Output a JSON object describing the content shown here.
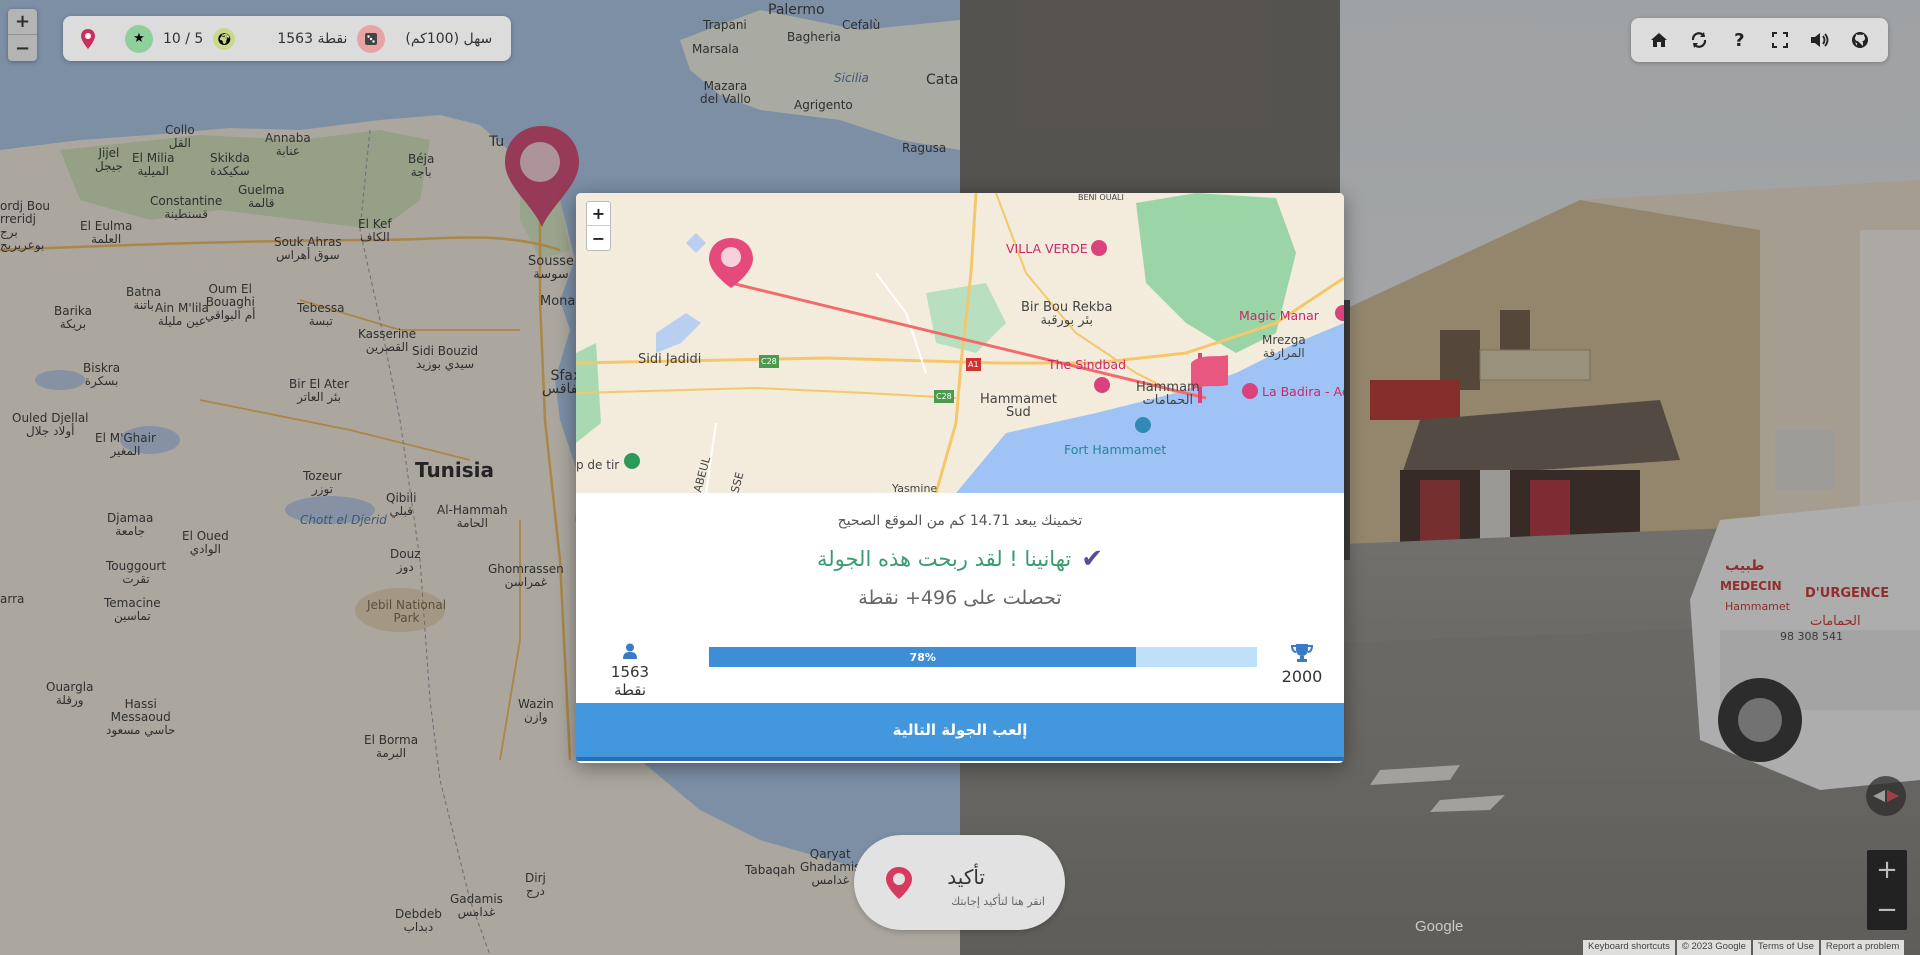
{
  "stats": {
    "mode_label": "سهل (100كم)",
    "score_label": "1563 نقطة",
    "round_label": "10 / 5"
  },
  "left_map": {
    "zoom_in": "+",
    "zoom_out": "−",
    "places": [
      {
        "name": "Palermo"
      },
      {
        "name": "Trapani"
      },
      {
        "name": "Marsala"
      },
      {
        "name": "Bagheria"
      },
      {
        "name": "Cefalù"
      },
      {
        "name": "Sicilia"
      },
      {
        "name": "Mazara\ndel Vallo"
      },
      {
        "name": "Agrigento"
      },
      {
        "name": "Ragusa"
      },
      {
        "name": "Cata"
      },
      {
        "name": "Collo\nالقل"
      },
      {
        "name": "Annaba\nعنابة"
      },
      {
        "name": "Jijel\nجيجل"
      },
      {
        "name": "El Milia\nالميلية"
      },
      {
        "name": "Skikda\nسكيكدة"
      },
      {
        "name": "Constantine\nقسنطينة"
      },
      {
        "name": "Guelma\nقالمة"
      },
      {
        "name": "Béja\nباجة"
      },
      {
        "name": "Tu"
      },
      {
        "name": "El Kef\nالكاف"
      },
      {
        "name": "Souk Ahras\nسوق أهراس"
      },
      {
        "name": "El Eulma\nالعلمة"
      },
      {
        "name": "Oum El\nBouaghi\nأم البواقي"
      },
      {
        "name": "Batna\nباتنة"
      },
      {
        "name": "Barika\nبريكة"
      },
      {
        "name": "Ain M'lila\nعين مليلة"
      },
      {
        "name": "Tebessa\nتبسة"
      },
      {
        "name": "Sousse\nسوسة"
      },
      {
        "name": "Monas"
      },
      {
        "name": "Kasserine\nالقصرين"
      },
      {
        "name": "Sidi Bouzid\nسيدي بوزيد"
      },
      {
        "name": "Biskra\nبسكرة"
      },
      {
        "name": "Bir El Ater\nبئر العاتر"
      },
      {
        "name": "Sfax\nصفاقس"
      },
      {
        "name": "Ouled Djellal\nأولاد جلال"
      },
      {
        "name": "Tunisia"
      },
      {
        "name": "El M'Ghair\nالمغير"
      },
      {
        "name": "Tozeur\nتوزر"
      },
      {
        "name": "Qibili\nقبلي"
      },
      {
        "name": "Al-Hammah\nالحامة"
      },
      {
        "name": "Djamaa\nجامعة"
      },
      {
        "name": "Chott el Djerid"
      },
      {
        "name": "El Oued\nالوادي"
      },
      {
        "name": "Touggourt\nتقرت"
      },
      {
        "name": "Douz\nدوز"
      },
      {
        "name": "Ghomrassen\nغمراسن"
      },
      {
        "name": "Jebil National\nPark"
      },
      {
        "name": "Temacine\nتماسين"
      },
      {
        "name": "Ouargla\nورقلة"
      },
      {
        "name": "Hassi\nMessaoud\nحاسي مسعود"
      },
      {
        "name": "El Borma\nالبرمة"
      },
      {
        "name": "Wazin\nوازن"
      },
      {
        "name": "Qaryat\nGhadamis\nغدامس"
      },
      {
        "name": "Tabaqah"
      },
      {
        "name": "Dirj\nدرج"
      },
      {
        "name": "Gadamis\nغدامس"
      },
      {
        "name": "Debdeb\nدبداب"
      },
      {
        "name": "ordj Bou\nrreridj\nبرج\nبوعريريج"
      },
      {
        "name": "arra"
      }
    ]
  },
  "toolbar": {
    "home_icon": "home-icon",
    "refresh_icon": "refresh-icon",
    "help_icon": "help-icon",
    "fullscreen_icon": "fullscreen-icon",
    "sound_icon": "volume-icon",
    "github_icon": "github-icon"
  },
  "modal": {
    "map": {
      "zoom_in": "+",
      "zoom_out": "−",
      "places": [
        {
          "name": "BENI OUALI"
        },
        {
          "name": "VILLA VERDE"
        },
        {
          "name": "Bir Bou Rekba\nبئر بورقبة"
        },
        {
          "name": "Magic Manar"
        },
        {
          "name": "Mrezga\nالمرازقة"
        },
        {
          "name": "Sidi Jadidi"
        },
        {
          "name": "The Sindbad"
        },
        {
          "name": "Hammamet\nSud"
        },
        {
          "name": "Hammam\nالحمامات"
        },
        {
          "name": "La Badira - Ac"
        },
        {
          "name": "Fort Hammamet"
        },
        {
          "name": "p de tir"
        },
        {
          "name": "Yasmine"
        },
        {
          "name": "ABEUL"
        },
        {
          "name": "SSE"
        },
        {
          "name": "C28"
        },
        {
          "name": "C28"
        },
        {
          "name": "A1"
        }
      ]
    },
    "distance_text": "تخمينك يبعد 14.71 كم من الموقع الصحيح",
    "congrats_text": "تهانينا ! لقد ربحت هذه الجولة",
    "points_earned": "تحصلت على 496+ نقطة",
    "user_score_label": "1563 نقطة",
    "target_score_label": "2000",
    "progress_label": "78%",
    "progress_value": 0.78,
    "next_button": "إلعب الجولة التالية"
  },
  "confirm": {
    "title": "تأكيد",
    "subtitle": "انقر هنا لتأكيد إجابتك"
  },
  "streetview": {
    "zoom_in": "+",
    "zoom_out": "−",
    "google": "Google",
    "footer": [
      "Keyboard shortcuts",
      "© 2023 Google",
      "Terms of Use",
      "Report a problem"
    ],
    "van_text": [
      "MEDECIN",
      "D'URGENCE",
      "Hammamet",
      "طبيب",
      "الحمامات",
      "98 308 541"
    ]
  },
  "colors": {
    "pin": "#c9305a",
    "guess_line": "#f06b6b",
    "progress_fill": "#3d8ed6",
    "progress_track": "#bee0f9",
    "button": "#4397dd",
    "congrats": "#3b9b6f"
  }
}
